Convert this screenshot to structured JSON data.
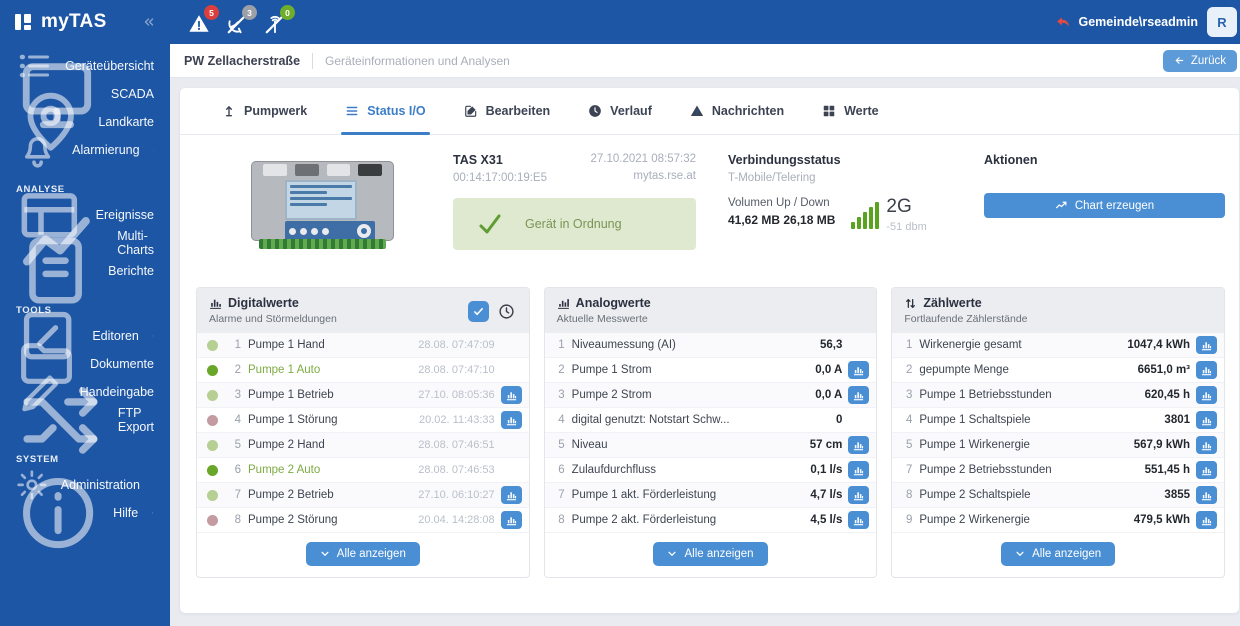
{
  "app": {
    "name": "myTAS"
  },
  "topbar": {
    "user": "Gemeinde\\rseadmin",
    "user_initial": "R",
    "alarms": [
      {
        "name": "alarms",
        "icon": "warning",
        "count": "5",
        "badge_color": "#d9403d"
      },
      {
        "name": "connection-lost",
        "icon": "satellite-off",
        "count": "3",
        "badge_color": "#9b9fa6"
      },
      {
        "name": "connection-restored",
        "icon": "antenna-off",
        "count": "0",
        "badge_color": "#6fae2b"
      }
    ]
  },
  "sidebar": {
    "sections": [
      {
        "title": "",
        "items": [
          {
            "label": "Geräteübersicht",
            "icon": "list",
            "chevron": false
          },
          {
            "label": "SCADA",
            "icon": "monitor",
            "chevron": false
          },
          {
            "label": "Landkarte",
            "icon": "map-pin",
            "chevron": false
          },
          {
            "label": "Alarmierung",
            "icon": "bell",
            "chevron": true
          }
        ]
      },
      {
        "title": "ANALYSE",
        "items": [
          {
            "label": "Ereignisse",
            "icon": "table",
            "chevron": false
          },
          {
            "label": "Multi-Charts",
            "icon": "line-chart",
            "chevron": false
          },
          {
            "label": "Berichte",
            "icon": "report",
            "chevron": false
          }
        ]
      },
      {
        "title": "TOOLS",
        "items": [
          {
            "label": "Editoren",
            "icon": "editor",
            "chevron": true
          },
          {
            "label": "Dokumente",
            "icon": "folder",
            "chevron": false
          },
          {
            "label": "Handeingabe",
            "icon": "pencil",
            "chevron": false
          },
          {
            "label": "FTP Export",
            "icon": "shuffle",
            "chevron": false
          }
        ]
      },
      {
        "title": "SYSTEM",
        "items": [
          {
            "label": "Administration",
            "icon": "gear",
            "chevron": true
          },
          {
            "label": "Hilfe",
            "icon": "help",
            "chevron": true
          }
        ]
      }
    ]
  },
  "header": {
    "breadcrumb_primary": "PW Zellacherstraße",
    "breadcrumb_secondary": "Geräteinformationen und Analysen",
    "back_label": "Zurück"
  },
  "tabs": [
    {
      "label": "Pumpwerk",
      "icon": "pump",
      "active": false
    },
    {
      "label": "Status I/O",
      "icon": "menu",
      "active": true
    },
    {
      "label": "Bearbeiten",
      "icon": "edit",
      "active": false
    },
    {
      "label": "Verlauf",
      "icon": "history",
      "active": false
    },
    {
      "label": "Nachrichten",
      "icon": "warning",
      "active": false
    },
    {
      "label": "Werte",
      "icon": "grid",
      "active": false
    }
  ],
  "device": {
    "model": "TAS X31",
    "mac": "00:14:17:00:19:E5",
    "timestamp": "27.10.2021 08:57:32",
    "host": "mytas.rse.at",
    "status_label": "Gerät in Ordnung",
    "connection_title": "Verbindungsstatus",
    "provider": "T-Mobile/Telering",
    "volume_label": "Volumen Up / Down",
    "volume_value": "41,62 MB 26,18 MB",
    "network_type": "2G",
    "signal_strength": "-51 dbm",
    "actions_title": "Aktionen",
    "chart_button_label": "Chart erzeugen"
  },
  "panels": {
    "digital": {
      "title": "Digitalwerte",
      "subtitle": "Alarme und Störmeldungen",
      "show_all": "Alle anzeigen",
      "dot_colors": {
        "light": "#b6cf92",
        "bright": "#69a62a",
        "fault": "#c49ba0"
      },
      "rows": [
        {
          "num": "1",
          "label": "Pumpe 1 Hand",
          "time": "28.08. 07:47:09",
          "dot": "light",
          "green": false,
          "chart": false
        },
        {
          "num": "2",
          "label": "Pumpe 1 Auto",
          "time": "28.08. 07:47:10",
          "dot": "bright",
          "green": true,
          "chart": false
        },
        {
          "num": "3",
          "label": "Pumpe 1 Betrieb",
          "time": "27.10. 08:05:36",
          "dot": "light",
          "green": false,
          "chart": true
        },
        {
          "num": "4",
          "label": "Pumpe 1 Störung",
          "time": "20.02. 11:43:33",
          "dot": "fault",
          "green": false,
          "chart": true
        },
        {
          "num": "5",
          "label": "Pumpe 2 Hand",
          "time": "28.08. 07:46:51",
          "dot": "light",
          "green": false,
          "chart": false
        },
        {
          "num": "6",
          "label": "Pumpe 2 Auto",
          "time": "28.08. 07:46:53",
          "dot": "bright",
          "green": true,
          "chart": false
        },
        {
          "num": "7",
          "label": "Pumpe 2 Betrieb",
          "time": "27.10. 06:10:27",
          "dot": "light",
          "green": false,
          "chart": true
        },
        {
          "num": "8",
          "label": "Pumpe 2 Störung",
          "time": "20.04. 14:28:08",
          "dot": "fault",
          "green": false,
          "chart": true
        }
      ]
    },
    "analog": {
      "title": "Analogwerte",
      "subtitle": "Aktuelle Messwerte",
      "show_all": "Alle anzeigen",
      "rows": [
        {
          "num": "1",
          "label": "Niveaumessung (AI)",
          "value": "56,3",
          "chart": false
        },
        {
          "num": "2",
          "label": "Pumpe 1 Strom",
          "value": "0,0 A",
          "chart": true
        },
        {
          "num": "3",
          "label": "Pumpe 2 Strom",
          "value": "0,0 A",
          "chart": true
        },
        {
          "num": "4",
          "label": "digital genutzt: Notstart Schw...",
          "value": "0",
          "chart": false
        },
        {
          "num": "5",
          "label": "Niveau",
          "value": "57 cm",
          "chart": true
        },
        {
          "num": "6",
          "label": "Zulaufdurchfluss",
          "value": "0,1 l/s",
          "chart": true
        },
        {
          "num": "7",
          "label": "Pumpe 1 akt. Förderleistung",
          "value": "4,7 l/s",
          "chart": true
        },
        {
          "num": "8",
          "label": "Pumpe 2 akt. Förderleistung",
          "value": "4,5 l/s",
          "chart": true
        }
      ]
    },
    "counter": {
      "title": "Zählwerte",
      "subtitle": "Fortlaufende Zählerstände",
      "show_all": "Alle anzeigen",
      "rows": [
        {
          "num": "1",
          "label": "Wirkenergie gesamt",
          "value": "1047,4 kWh",
          "chart": true
        },
        {
          "num": "2",
          "label": "gepumpte Menge",
          "value": "6651,0 m³",
          "chart": true
        },
        {
          "num": "3",
          "label": "Pumpe 1 Betriebsstunden",
          "value": "620,45 h",
          "chart": true
        },
        {
          "num": "4",
          "label": "Pumpe 1 Schaltspiele",
          "value": "3801",
          "chart": true
        },
        {
          "num": "5",
          "label": "Pumpe 1 Wirkenergie",
          "value": "567,9 kWh",
          "chart": true
        },
        {
          "num": "7",
          "label": "Pumpe 2 Betriebsstunden",
          "value": "551,45 h",
          "chart": true
        },
        {
          "num": "8",
          "label": "Pumpe 2 Schaltspiele",
          "value": "3855",
          "chart": true
        },
        {
          "num": "9",
          "label": "Pumpe 2 Wirkenergie",
          "value": "479,5 kWh",
          "chart": true
        }
      ]
    }
  },
  "colors": {
    "sidebar_blue": "#1d56a4",
    "accent_blue": "#4a8fd4",
    "status_green_bg": "#dfe9d0",
    "signal_green": "#5aa321"
  }
}
